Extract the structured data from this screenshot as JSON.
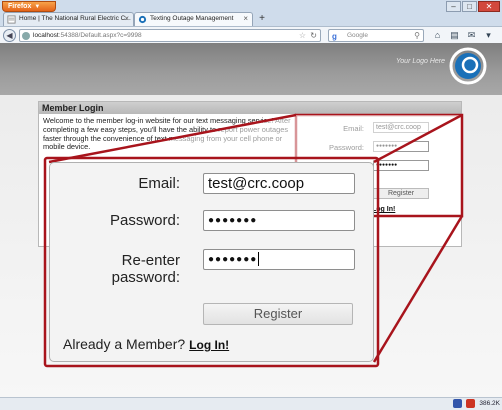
{
  "browser": {
    "menu_button": "Firefox",
    "window_buttons": {
      "minimize": "–",
      "maximize": "□",
      "close": "✕"
    },
    "tabs": [
      {
        "label": "Home | The National Rural Electric C..."
      },
      {
        "label": "Texting Outage Management"
      }
    ],
    "new_tab": "+",
    "url_host": "localhost",
    "url_rest": ":54388/Default.aspx?c=9998",
    "search_placeholder": "Google",
    "status_speed": "386.2K"
  },
  "header": {
    "logo_text": "Your Logo Here",
    "logo_color": "#1a70b8"
  },
  "login_panel": {
    "title": "Member Login",
    "welcome_text": "Welcome to the member log-in website for our text messaging service! After completing a few easy steps, you'll have the ability to report power outages faster through the convenience of text messaging from your cell phone or mobile device.",
    "email_label": "Email:",
    "email_value": "test@crc.coop",
    "password_label": "Password:",
    "password_mask": "●●●●●●●",
    "reenter_mask": "●●●●●●●",
    "register_label": "Register",
    "login_link": "Log In!"
  },
  "zoom_form": {
    "email_label": "Email:",
    "email_value": "test@crc.coop",
    "password_label": "Password:",
    "password_mask": "●●●●●●●",
    "reenter_label_line1": "Re-enter",
    "reenter_label_line2": "password:",
    "reenter_mask": "●●●●●●●",
    "register_label": "Register",
    "already_text": "Already a Member?",
    "login_link": "Log In!"
  },
  "colors": {
    "callout_red": "#a8141c"
  }
}
